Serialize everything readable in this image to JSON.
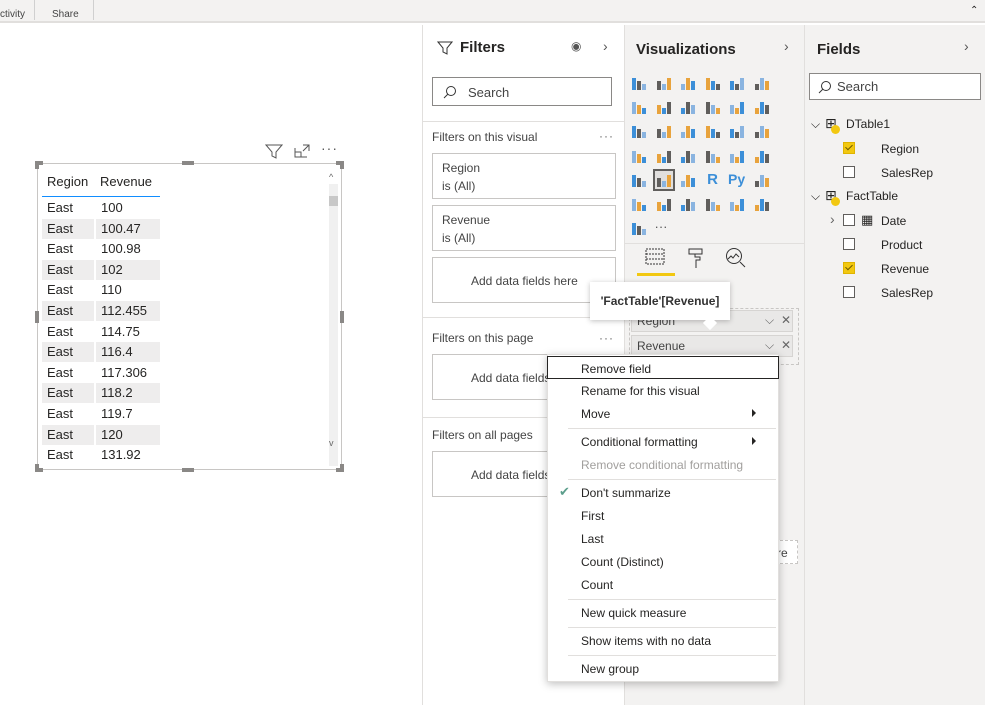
{
  "ribbon": {
    "tabs": [
      "ctivity",
      "Share"
    ]
  },
  "table": {
    "headers": [
      "Region",
      "Revenue"
    ],
    "rows": [
      [
        "East",
        "100"
      ],
      [
        "East",
        "100.47"
      ],
      [
        "East",
        "100.98"
      ],
      [
        "East",
        "102"
      ],
      [
        "East",
        "110"
      ],
      [
        "East",
        "112.455"
      ],
      [
        "East",
        "114.75"
      ],
      [
        "East",
        "116.4"
      ],
      [
        "East",
        "117.306"
      ],
      [
        "East",
        "118.2"
      ],
      [
        "East",
        "119.7"
      ],
      [
        "East",
        "120"
      ],
      [
        "East",
        "131.92"
      ]
    ]
  },
  "filters": {
    "title": "Filters",
    "search_placeholder": "Search",
    "on_visual_label": "Filters on this visual",
    "cards": [
      {
        "field": "Region",
        "state": "is (All)"
      },
      {
        "field": "Revenue",
        "state": "is (All)"
      }
    ],
    "add_fields": "Add data fields here",
    "on_page_label": "Filters on this page",
    "all_pages_label": "Filters on all pages",
    "add_fields_truncated": "Add data fields"
  },
  "visualizations": {
    "title": "Visualizations",
    "wells": [
      "Region",
      "Revenue"
    ],
    "add_truncated": "re",
    "icons": [
      "stacked-bar",
      "stacked-column",
      "clustered-bar",
      "clustered-column",
      "100-bar",
      "100-column",
      "line",
      "area",
      "stacked-area",
      "line-column",
      "line-clustered",
      "ribbon",
      "waterfall",
      "funnel",
      "scatter",
      "pie",
      "donut",
      "treemap",
      "map",
      "filled-map",
      "gauge",
      "card",
      "multi-row-card",
      "kpi",
      "slicer",
      "table",
      "matrix",
      "r-visual",
      "python-visual",
      "key-influencers",
      "decomposition-tree",
      "qa",
      "smart-narrative",
      "paginated-report",
      "arcgis",
      "power-apps",
      "power-automate",
      "more"
    ],
    "r_label": "R",
    "py_label": "Py",
    "more_label": "···"
  },
  "tooltip": "'FactTable'[Revenue]",
  "context_menu": {
    "items": [
      {
        "label": "Remove field",
        "state": "focused"
      },
      {
        "label": "Rename for this visual"
      },
      {
        "label": "Move",
        "submenu": true
      },
      {
        "label": "Conditional formatting",
        "submenu": true
      },
      {
        "label": "Remove conditional formatting",
        "disabled": true
      },
      {
        "label": "Don't summarize",
        "checked": true
      },
      {
        "label": "First"
      },
      {
        "label": "Last"
      },
      {
        "label": "Count (Distinct)"
      },
      {
        "label": "Count"
      },
      {
        "label": "New quick measure"
      },
      {
        "label": "Show items with no data"
      },
      {
        "label": "New group"
      }
    ]
  },
  "fields": {
    "title": "Fields",
    "search_placeholder": "Search",
    "tables": [
      {
        "name": "DTable1",
        "fields": [
          {
            "name": "Region",
            "checked": true
          },
          {
            "name": "SalesRep",
            "checked": false
          }
        ]
      },
      {
        "name": "FactTable",
        "fields": [
          {
            "name": "Date",
            "checked": false
          },
          {
            "name": "Product",
            "checked": false
          },
          {
            "name": "Revenue",
            "checked": true
          },
          {
            "name": "SalesRep",
            "checked": false
          }
        ]
      }
    ]
  },
  "colors": {
    "accent_yellow": "#f2c811",
    "table_header_line": "#118dff",
    "check_green": "#5c9e8c",
    "icon_blue": "#3c8fd8"
  }
}
